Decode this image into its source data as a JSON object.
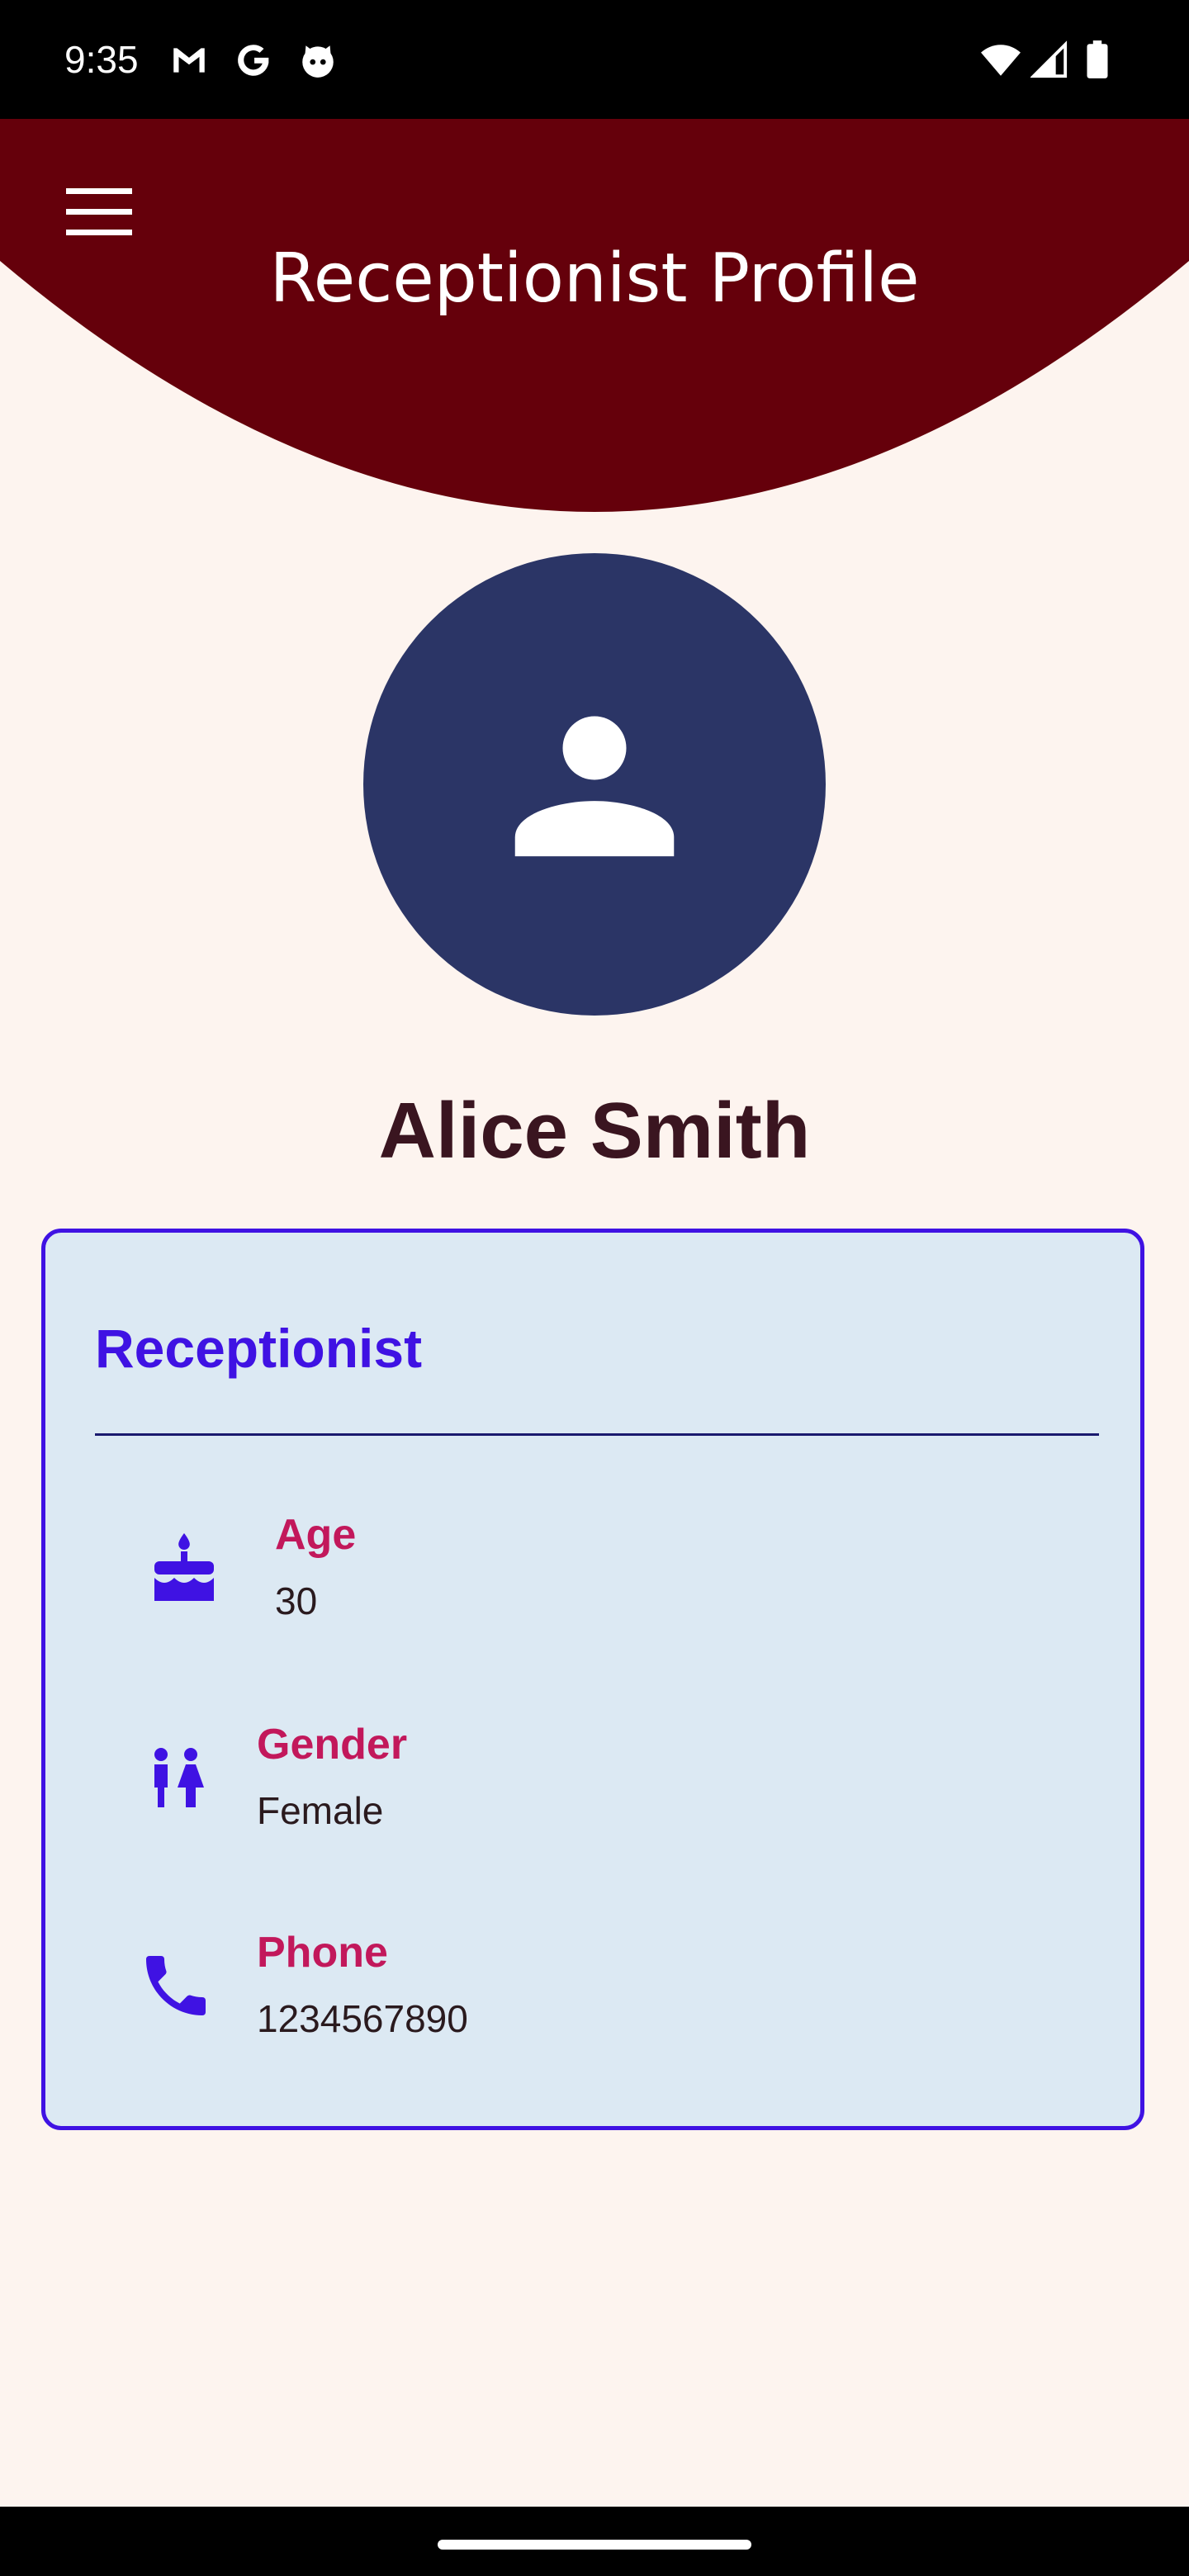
{
  "status_bar": {
    "time": "9:35",
    "left_icons": [
      "gmail-icon",
      "google-icon",
      "github-icon"
    ],
    "right_icons": [
      "wifi-icon",
      "signal-icon",
      "battery-icon"
    ]
  },
  "header": {
    "title": "Receptionist Profile",
    "menu_icon": "hamburger-menu-icon",
    "background_color": "#65000b"
  },
  "profile": {
    "avatar_icon": "person-icon",
    "avatar_color": "#2b3566",
    "name": "Alice Smith"
  },
  "card": {
    "title": "Receptionist",
    "accent_color": "#3f12e3",
    "label_color": "#c2185b",
    "items": [
      {
        "icon": "cake-icon",
        "label": "Age",
        "value": "30"
      },
      {
        "icon": "wc-icon",
        "label": "Gender",
        "value": "Female"
      },
      {
        "icon": "phone-icon",
        "label": "Phone",
        "value": "1234567890"
      }
    ]
  }
}
